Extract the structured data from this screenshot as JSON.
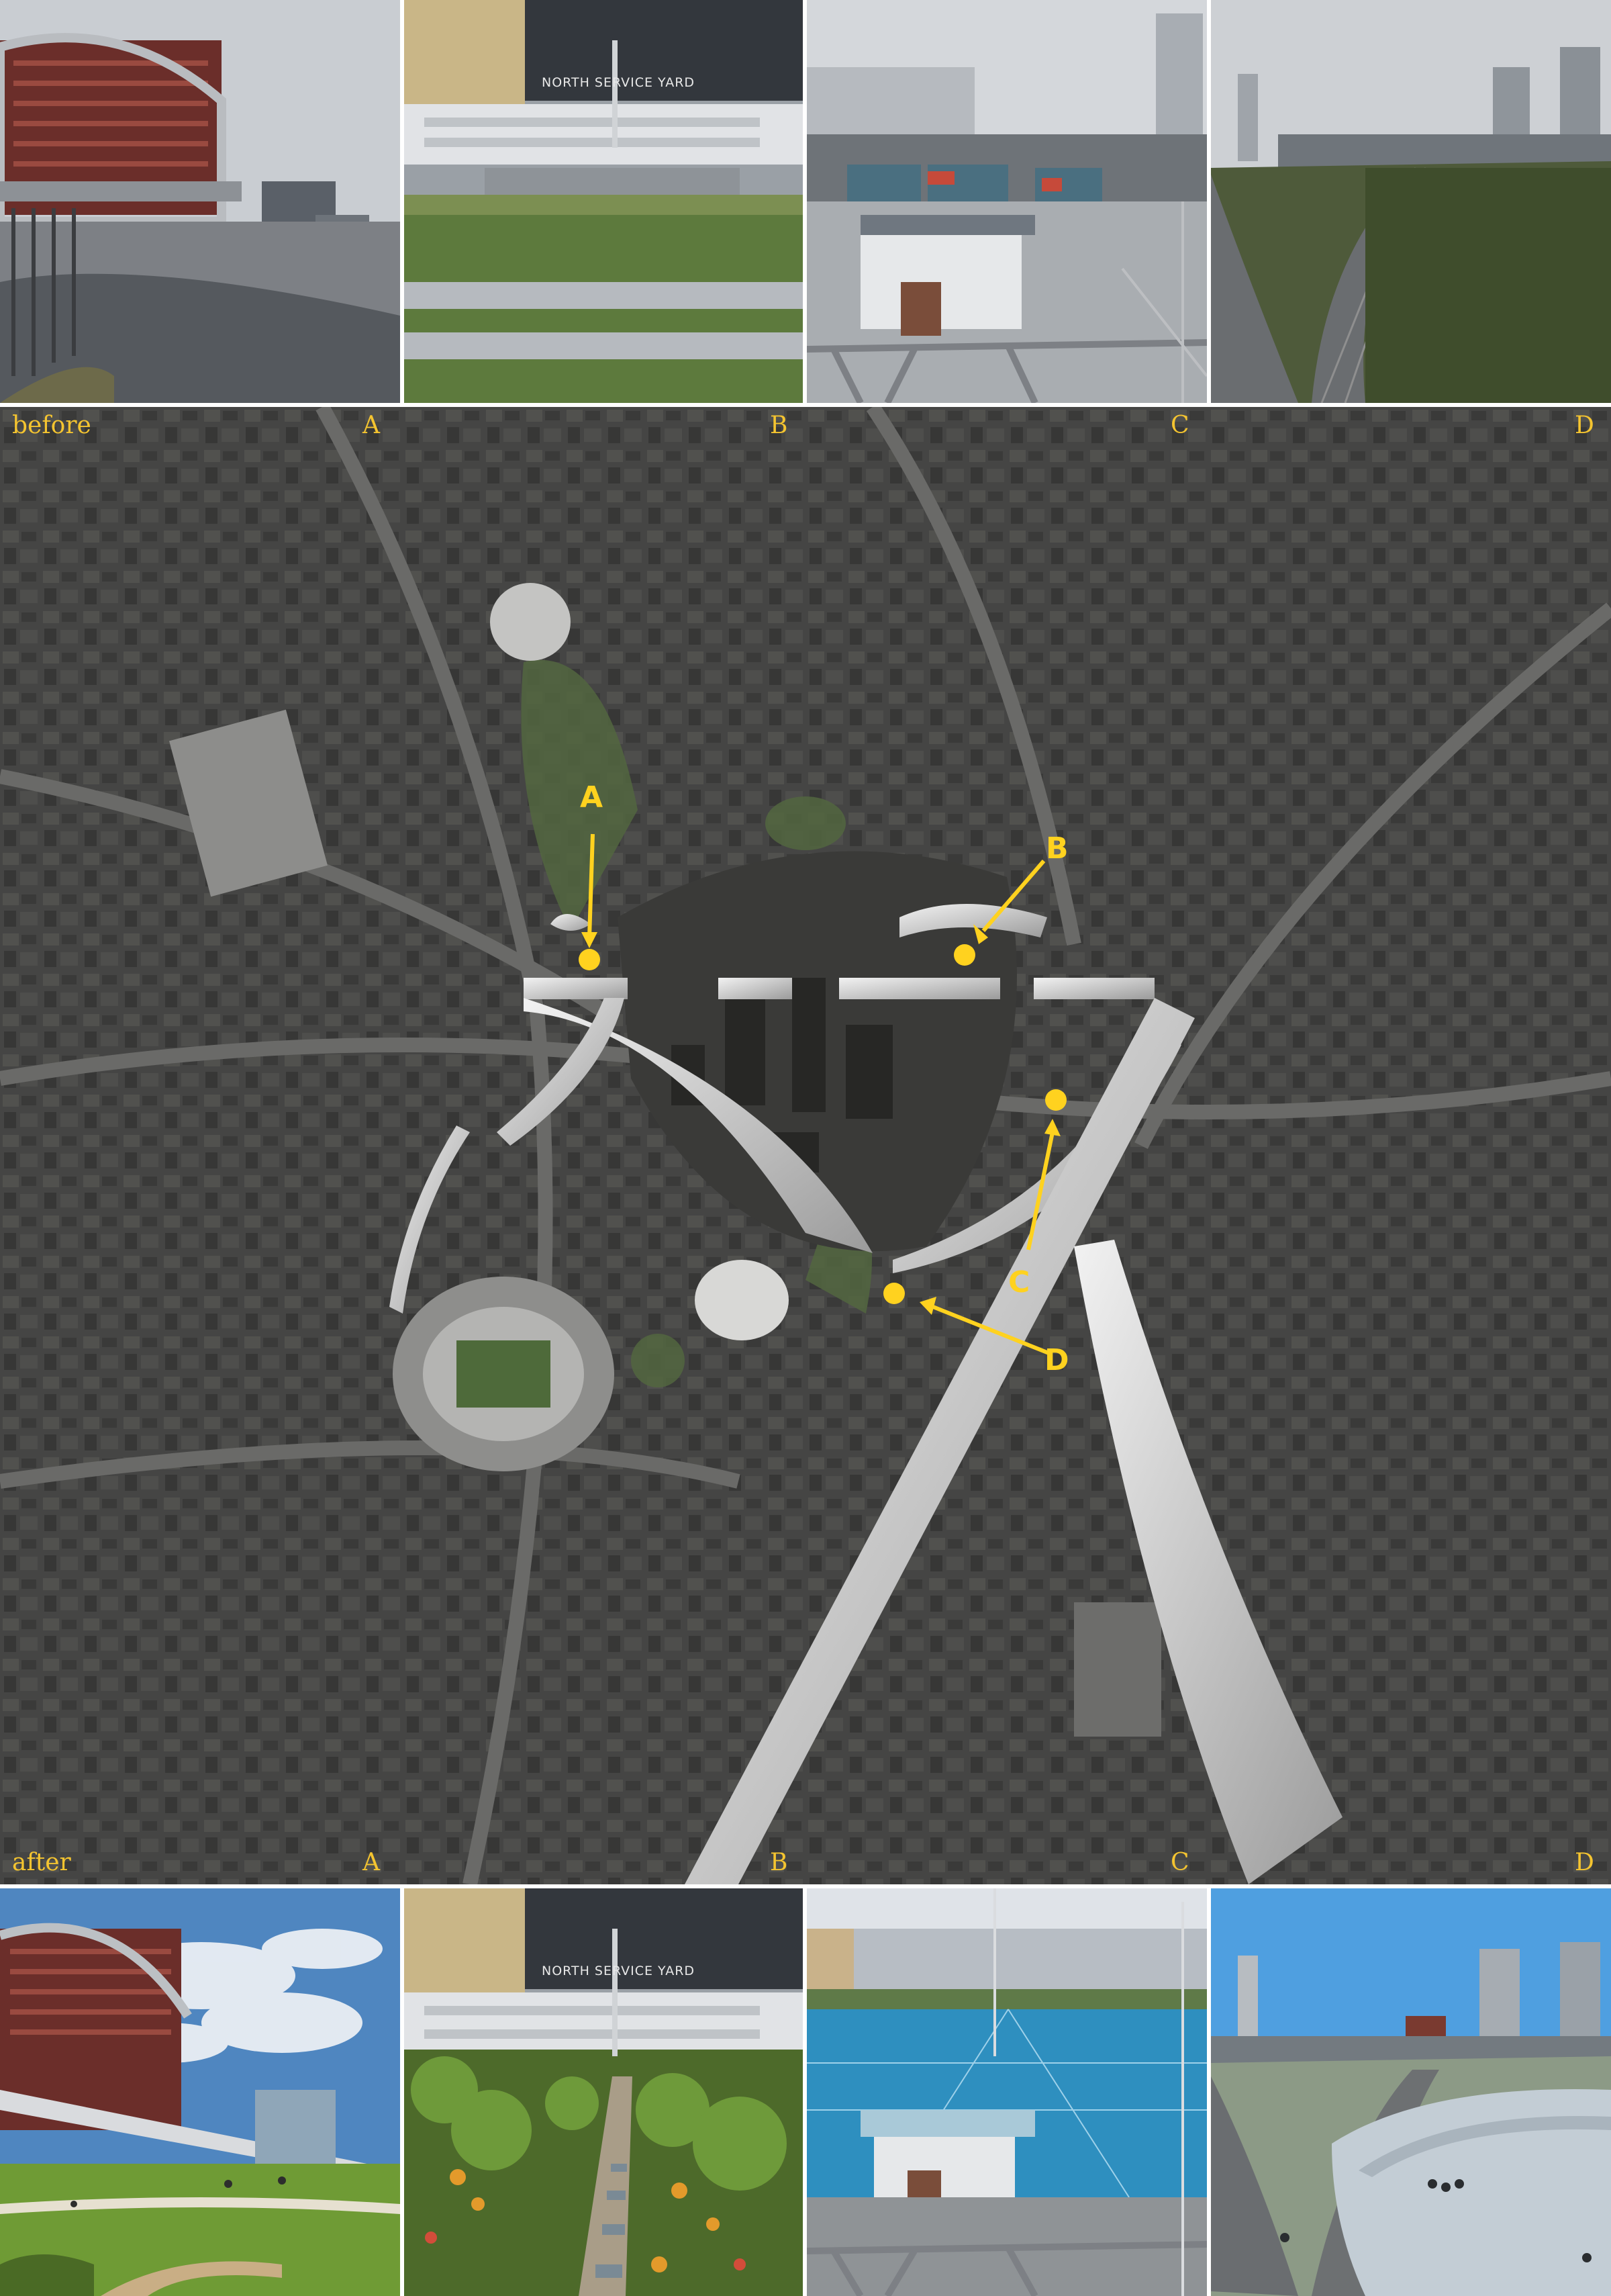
{
  "panels": {
    "before_label": "before",
    "after_label": "after",
    "column_letters": [
      "A",
      "B",
      "C",
      "D"
    ]
  },
  "photos": {
    "before_B_sign": "NORTH SERVICE YARD",
    "after_B_sign": "NORTH SERVICE YARD"
  },
  "map": {
    "markers": [
      {
        "letter": "A"
      },
      {
        "letter": "B"
      },
      {
        "letter": "C"
      },
      {
        "letter": "D"
      }
    ]
  },
  "colors": {
    "accent": "#f4c430",
    "marker": "#ffd21f",
    "map_base": "#4a4a48",
    "green_area": "#5f7d4a",
    "elevated_path": "#d9d9d9"
  }
}
